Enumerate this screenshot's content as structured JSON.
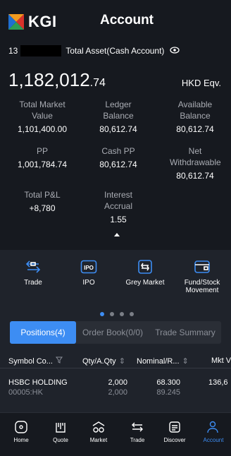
{
  "colors": {
    "accent": "#3d8df3",
    "background": "#1f232b",
    "panel": "#16191f"
  },
  "header": {
    "brand": "KGI",
    "title": "Account",
    "account_prefix": "13",
    "total_asset_label": "Total Asset(Cash Account)",
    "total_value_main": "1,182,012",
    "total_value_decimal": ".74",
    "currency": "HKD Eqv."
  },
  "metrics": [
    {
      "label": "Total Market Value",
      "value": "1,101,400.00"
    },
    {
      "label": "Ledger Balance",
      "value": "80,612.74"
    },
    {
      "label": "Available Balance",
      "value": "80,612.74"
    },
    {
      "label": "PP",
      "value": "1,001,784.74"
    },
    {
      "label": "Cash PP",
      "value": "80,612.74"
    },
    {
      "label": "Net Withdrawable",
      "value": "80,612.74"
    },
    {
      "label": "Total P&L",
      "value": "+8,780"
    },
    {
      "label": "Interest Accrual",
      "value": "1.55"
    }
  ],
  "shortcuts": [
    {
      "label": "Trade",
      "icon": "transfer-arrows-icon"
    },
    {
      "label": "IPO",
      "icon": "ipo-icon"
    },
    {
      "label": "Grey Market",
      "icon": "grey-market-icon"
    },
    {
      "label": "Fund/Stock Movement",
      "icon": "wallet-icon"
    }
  ],
  "carousel": {
    "pages": 4,
    "active": 0
  },
  "tabs": [
    {
      "label": "Positions(4)",
      "active": true
    },
    {
      "label": "Order Book(0/0)",
      "active": false
    },
    {
      "label": "Trade Summary",
      "active": false
    }
  ],
  "table": {
    "headers": [
      "Symbol Co...",
      "Qty/A.Qty",
      "Nominal/R...",
      "Mkt V"
    ],
    "rows": [
      {
        "name": "HSBC HOLDING",
        "code": "00005:HK",
        "qty": "2,000",
        "aqty": "2,000",
        "nominal": "68.300",
        "ref": "89.245",
        "mkt": "136,6"
      }
    ]
  },
  "tabbar": [
    {
      "label": "Home",
      "icon": "home-icon",
      "active": false
    },
    {
      "label": "Quote",
      "icon": "quote-icon",
      "active": false
    },
    {
      "label": "Market",
      "icon": "market-icon",
      "active": false
    },
    {
      "label": "Trade",
      "icon": "trade-icon",
      "active": false
    },
    {
      "label": "Discover",
      "icon": "discover-icon",
      "active": false
    },
    {
      "label": "Account",
      "icon": "account-icon",
      "active": true
    }
  ]
}
